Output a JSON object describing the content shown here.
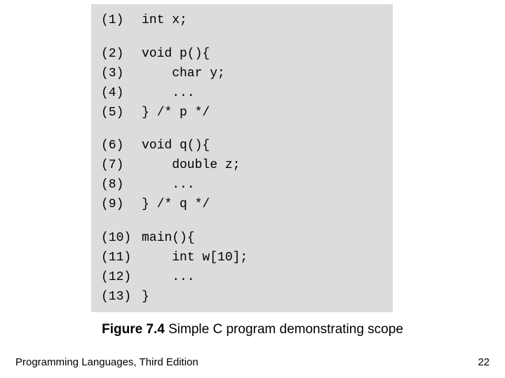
{
  "code": {
    "lines": [
      {
        "n": "(1)",
        "t": "int x;"
      },
      {
        "blank": true
      },
      {
        "n": "(2)",
        "t": "void p(){"
      },
      {
        "n": "(3)",
        "t": "    char y;"
      },
      {
        "n": "(4)",
        "t": "    ..."
      },
      {
        "n": "(5)",
        "t": "} /* p */"
      },
      {
        "blank": true
      },
      {
        "n": "(6)",
        "t": "void q(){"
      },
      {
        "n": "(7)",
        "t": "    double z;"
      },
      {
        "n": "(8)",
        "t": "    ..."
      },
      {
        "n": "(9)",
        "t": "} /* q */"
      },
      {
        "blank": true
      },
      {
        "n": "(10)",
        "t": "main(){"
      },
      {
        "n": "(11)",
        "t": "    int w[10];"
      },
      {
        "n": "(12)",
        "t": "    ..."
      },
      {
        "n": "(13)",
        "t": "}"
      }
    ]
  },
  "caption": {
    "fignum": "Figure 7.4",
    "text": " Simple C program demonstrating scope"
  },
  "footer": {
    "book": "Programming Languages, Third Edition",
    "page": "22"
  }
}
